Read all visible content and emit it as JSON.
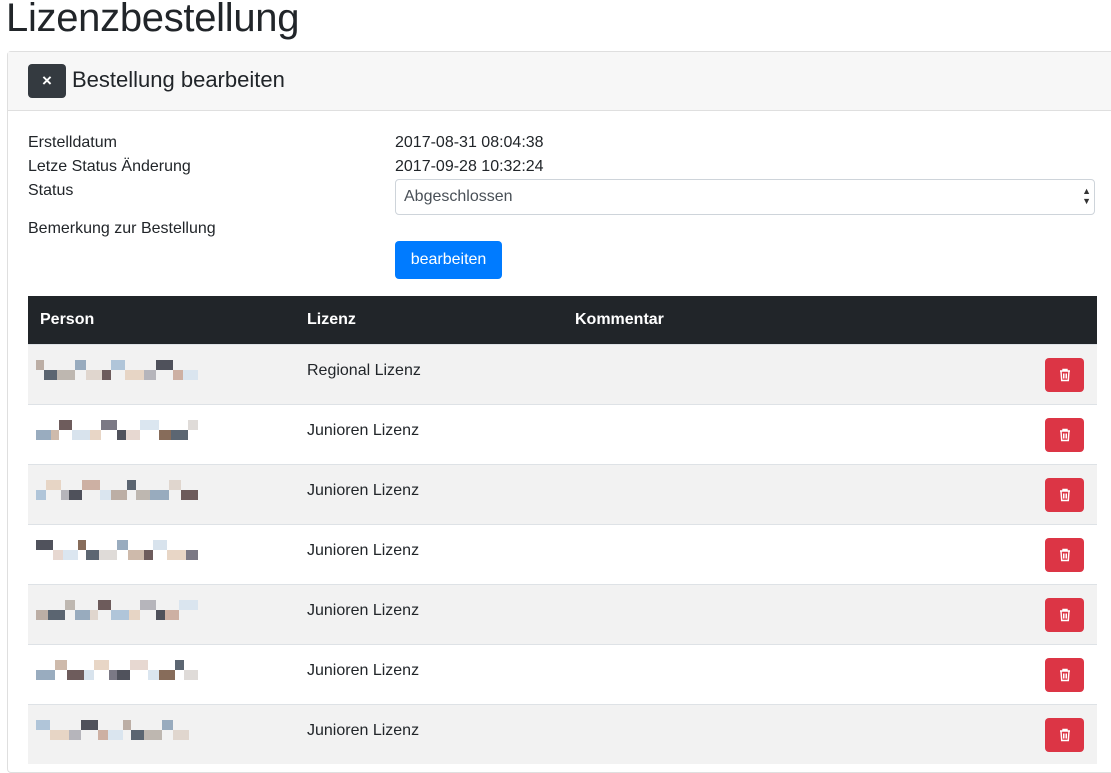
{
  "page": {
    "title": "Lizenzbestellung"
  },
  "card": {
    "title": "Bestellung bearbeiten",
    "close_label": "×"
  },
  "info": {
    "created_label": "Erstelldatum",
    "created_value": "2017-08-31 08:04:38",
    "changed_label": "Letze Status Änderung",
    "changed_value": "2017-09-28 10:32:24",
    "status_label": "Status",
    "status_value": "Abgeschlossen",
    "remark_label": "Bemerkung zur Bestellung"
  },
  "buttons": {
    "edit_label": "bearbeiten"
  },
  "table": {
    "headers": [
      "Person",
      "Lizenz",
      "Kommentar"
    ],
    "rows": [
      {
        "license": "Regional Lizenz",
        "comment": ""
      },
      {
        "license": "Junioren Lizenz",
        "comment": ""
      },
      {
        "license": "Junioren Lizenz",
        "comment": ""
      },
      {
        "license": "Junioren Lizenz",
        "comment": ""
      },
      {
        "license": "Junioren Lizenz",
        "comment": ""
      },
      {
        "license": "Junioren Lizenz",
        "comment": ""
      },
      {
        "license": "Junioren Lizenz",
        "comment": ""
      }
    ]
  },
  "icons": {
    "close": "close-icon",
    "delete": "trash-icon",
    "select": "select-arrows-icon"
  },
  "colors": {
    "primary": "#007bff",
    "danger": "#dc3545",
    "dark": "#212529"
  }
}
